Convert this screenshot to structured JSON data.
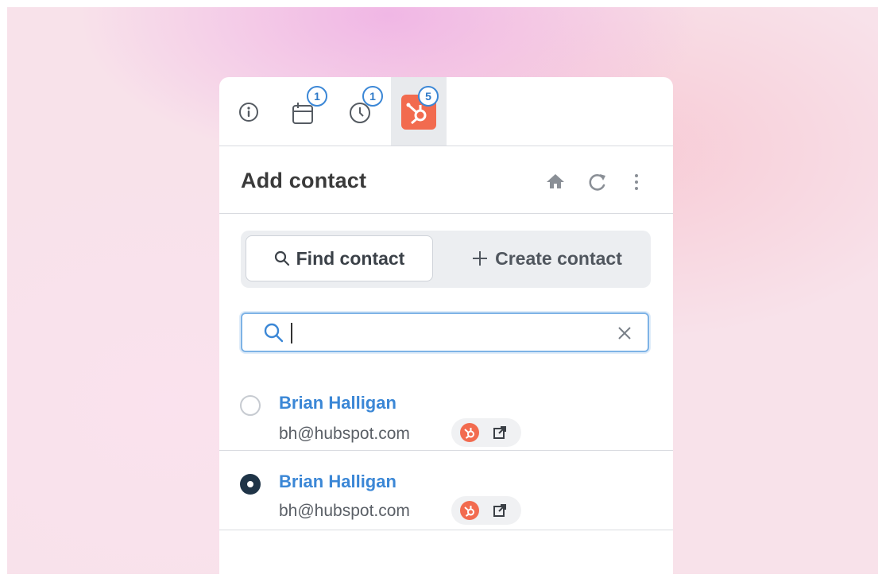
{
  "tabs": [
    {
      "icon": "info-icon"
    },
    {
      "icon": "calendar-icon",
      "badge": "1"
    },
    {
      "icon": "clock-icon",
      "badge": "1"
    },
    {
      "icon": "hubspot-icon",
      "badge": "5",
      "active": true
    }
  ],
  "header": {
    "title": "Add contact",
    "icons": [
      "home-icon",
      "refresh-icon",
      "more-vertical-icon"
    ]
  },
  "segment": {
    "find_label": "Find contact",
    "create_label": "Create contact",
    "active": "find"
  },
  "search": {
    "value": "",
    "placeholder": ""
  },
  "contacts": [
    {
      "name": "Brian Halligan",
      "email": "bh@hubspot.com",
      "selected": false
    },
    {
      "name": "Brian Halligan",
      "email": "bh@hubspot.com",
      "selected": true
    }
  ],
  "colors": {
    "accent": "#3b87d6",
    "hubspot": "#f26b4f",
    "radio_selected": "#1f3447"
  }
}
